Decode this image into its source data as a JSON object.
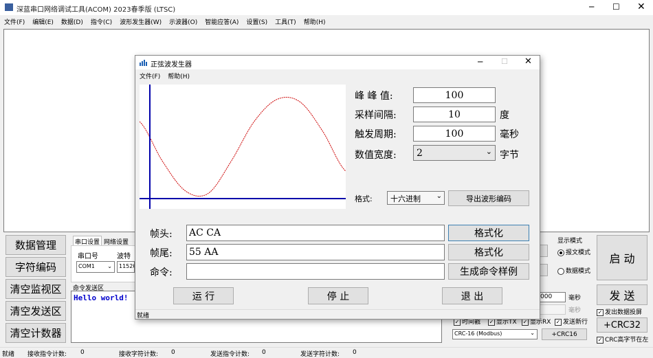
{
  "main": {
    "title": "深蓝串口网络调试工具(ACOM) 2023春季版 (LTSC)",
    "menu": [
      "文件(F)",
      "编辑(E)",
      "数据(D)",
      "指令(C)",
      "波形发生器(W)",
      "示波器(O)",
      "智能应答(A)",
      "设置(S)",
      "工具(T)",
      "帮助(H)"
    ],
    "left_buttons": [
      "数据管理",
      "字符编码",
      "清空监视区",
      "清空发送区",
      "清空计数器"
    ],
    "tabs": [
      "串口设置",
      "网络设置"
    ],
    "port_label": "串口号",
    "port_value": "COM1",
    "baud_label": "波特",
    "baud_value": "11520",
    "send_area_label": "命令发送区",
    "send_text": "Hello world!",
    "display_mode_title": "显示模式",
    "mode_packet": "报文模式",
    "mode_data": "数据模式",
    "start_button": "启 动",
    "send_button": "发 送",
    "interval_value": "000",
    "interval_unit": "毫秒",
    "show_time": "时间戳",
    "show_tx": "显示TX",
    "show_rx": "显示RX",
    "send_newline": "发送新行",
    "send_echo": "发出数据投屏",
    "crc_select": "CRC-16 (Modbus)",
    "crc16_button": "+CRC16",
    "crc32_button": "+CRC32",
    "crc_high_first": "CRC高字节在左",
    "status": {
      "ready": "就绪",
      "recv_cmd_label": "接收指令计数:",
      "recv_cmd": "0",
      "recv_char_label": "接收字符计数:",
      "recv_char": "0",
      "send_cmd_label": "发送指令计数:",
      "send_cmd": "0",
      "send_char_label": "发送字符计数:",
      "send_char": "0"
    }
  },
  "dialog": {
    "title": "正弦波发生器",
    "menu": [
      "文件(F)",
      "帮助(H)"
    ],
    "peak_label": "峰 峰 值:",
    "peak_value": "100",
    "interval_label": "采样间隔:",
    "interval_value": "10",
    "interval_unit": "度",
    "period_label": "触发周期:",
    "period_value": "100",
    "period_unit": "毫秒",
    "width_label": "数值宽度:",
    "width_value": "2",
    "width_unit": "字节",
    "format_label": "格式:",
    "format_value": "十六进制",
    "export_button": "导出波形编码",
    "head_label": "帧头:",
    "head_value": "AC CA",
    "tail_label": "帧尾:",
    "tail_value": "55 AA",
    "cmd_label": "命令:",
    "cmd_value": "",
    "format_btn1": "格式化",
    "format_btn2": "格式化",
    "gen_button": "生成命令样例",
    "run_button": "运 行",
    "stop_button": "停 止",
    "exit_button": "退 出",
    "status": "就绪"
  },
  "colors": {
    "accent_text": "#0000cc",
    "wave": "#cc0000",
    "axis": "#0000aa"
  },
  "chart_data": {
    "type": "line",
    "title": "",
    "xlabel": "",
    "ylabel": "",
    "x": [
      -1,
      0,
      1,
      2,
      3,
      4,
      5,
      6,
      7,
      8
    ],
    "y": [
      0.5,
      -0.3,
      -0.9,
      -0.95,
      -0.3,
      0.5,
      0.95,
      0.9,
      0.3,
      -0.5
    ],
    "grid": false
  }
}
